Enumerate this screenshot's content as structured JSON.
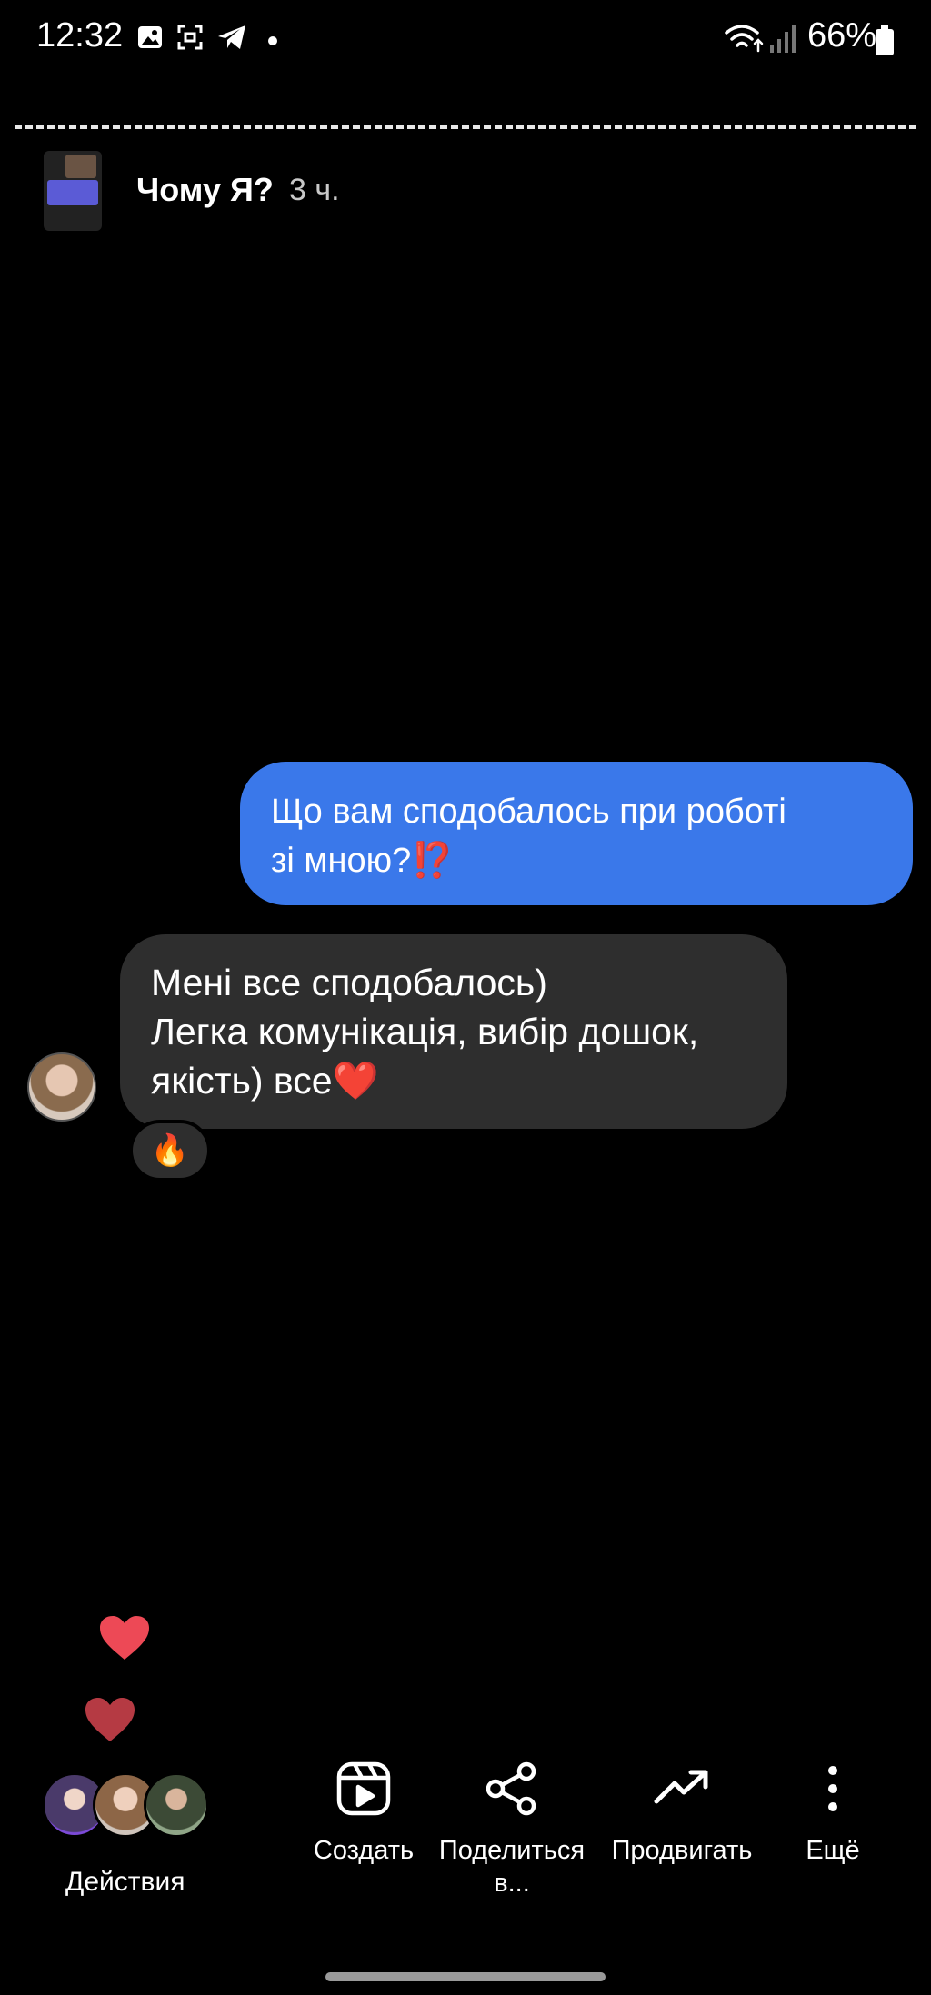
{
  "status_bar": {
    "time": "12:32",
    "battery_percent": "66%",
    "icons": [
      "gallery-icon",
      "screenshot-icon",
      "telegram-icon",
      "dot-icon",
      "wifi-icon",
      "signal-icon",
      "battery-icon"
    ]
  },
  "story": {
    "title": "Чому Я?",
    "time_ago": "3 ч."
  },
  "chat": {
    "outgoing": {
      "lines": [
        "Що вам сподобалось при роботі",
        "зі мною?⁉️"
      ]
    },
    "incoming": {
      "lines": [
        "Мені все сподобалось)",
        "Легка комунікація, вибір дошок,",
        "якість) все❤️"
      ],
      "reaction": "🔥"
    }
  },
  "bottom_bar": {
    "viewers_label": "Действия",
    "actions": [
      {
        "label": "Создать",
        "icon": "reels-icon"
      },
      {
        "label": "Поделиться",
        "label2": "в...",
        "icon": "share-icon"
      },
      {
        "label": "Продвигать",
        "icon": "trending-up-icon"
      },
      {
        "label": "Ещё",
        "icon": "more-vertical-icon"
      }
    ]
  },
  "colors": {
    "background": "#000000",
    "outgoing_bubble": "#3a78ea",
    "incoming_bubble": "#2e2e2e",
    "heart": "#ed4956"
  }
}
